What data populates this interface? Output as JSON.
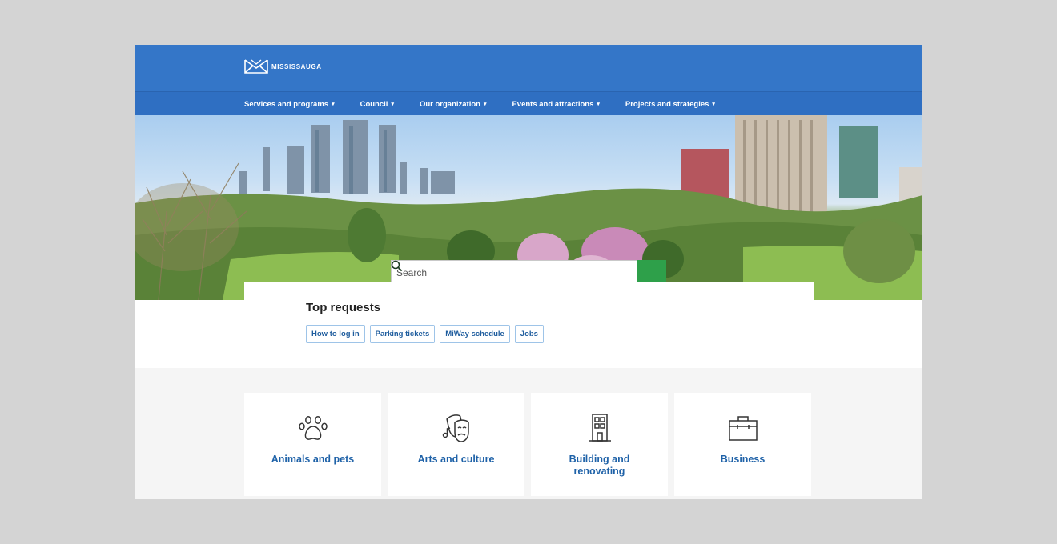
{
  "header": {
    "logo_text": "mississauga",
    "nav": [
      {
        "label": "Services and programs",
        "caret": "▾"
      },
      {
        "label": "Council",
        "caret": "▾"
      },
      {
        "label": "Our organization",
        "caret": "▾"
      },
      {
        "label": "Events and attractions",
        "caret": "▾"
      },
      {
        "label": "Projects and strategies",
        "caret": "▾"
      }
    ]
  },
  "search": {
    "placeholder": "Search",
    "value": "",
    "button_icon": "search-icon"
  },
  "top_requests": {
    "title": "Top requests",
    "tags": [
      "How to log in",
      "Parking tickets",
      "MiWay schedule",
      "Jobs"
    ]
  },
  "categories": [
    {
      "label": "Animals and pets",
      "icon": "paw-icon"
    },
    {
      "label": "Arts and culture",
      "icon": "theatre-masks-icon"
    },
    {
      "label": "Building and renovating",
      "icon": "building-icon"
    },
    {
      "label": "Business",
      "icon": "briefcase-icon"
    }
  ],
  "colors": {
    "header_blue": "#3476c8",
    "search_green": "#2ea04a",
    "link_blue": "#1f62a8"
  }
}
